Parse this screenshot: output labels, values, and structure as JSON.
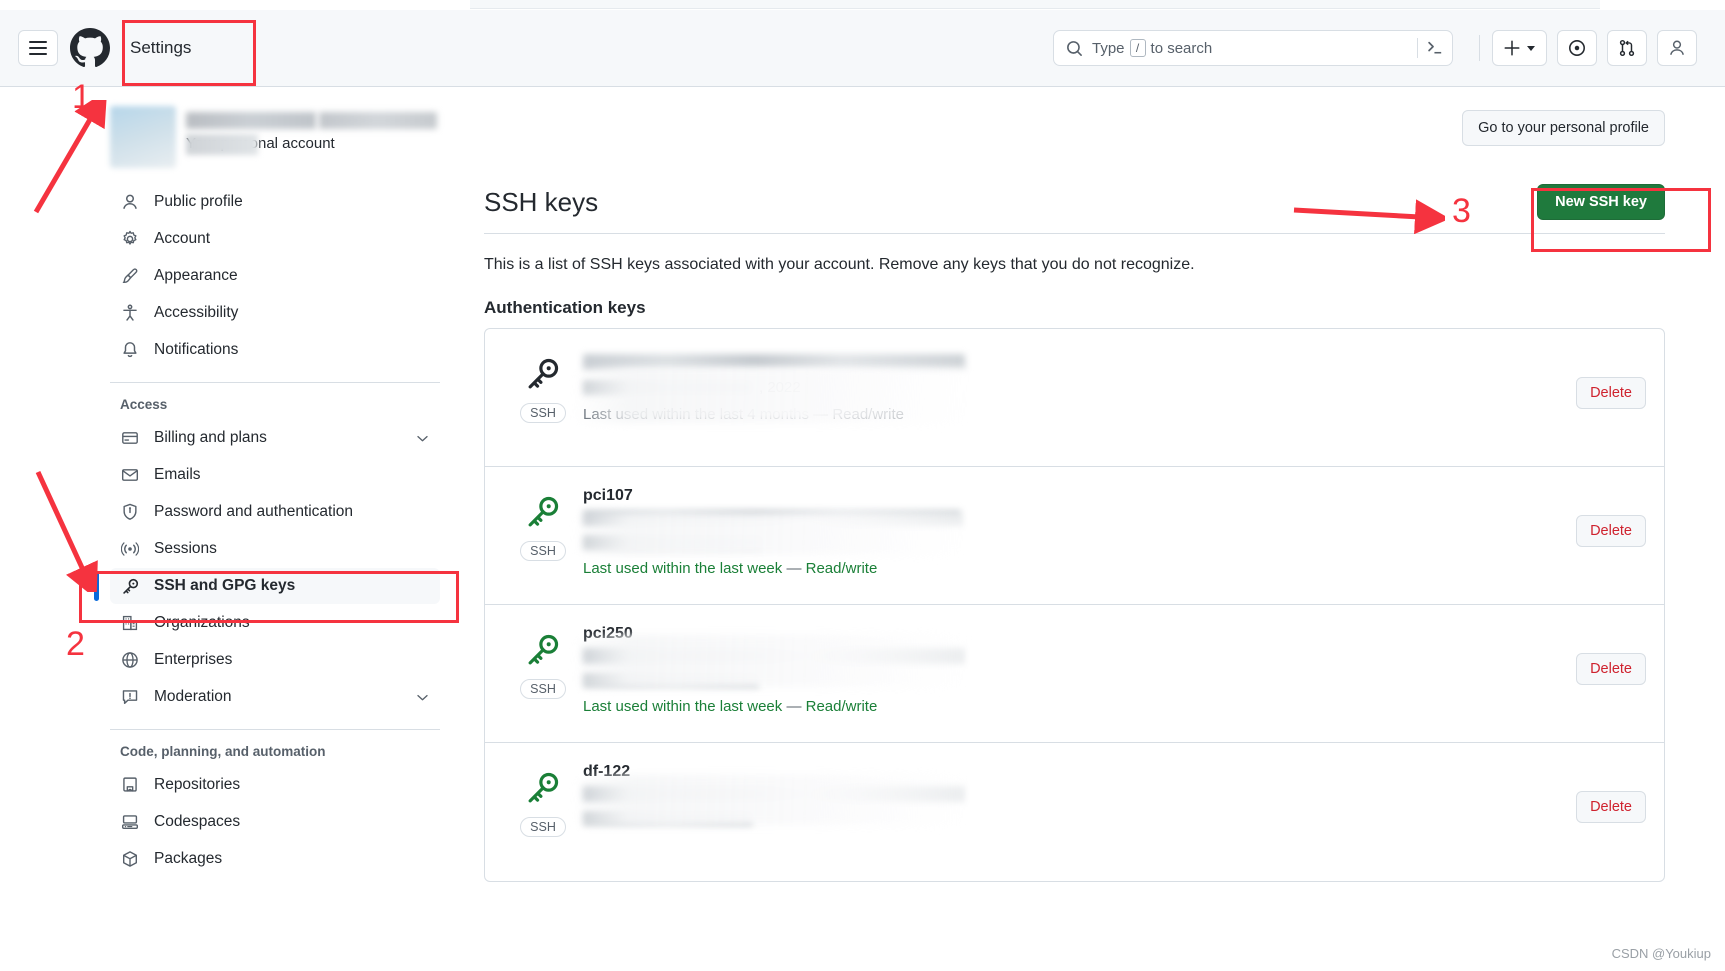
{
  "header": {
    "menu_label": "Open menu",
    "logo_label": "GitHub",
    "title": "Settings",
    "search": {
      "placeholder_prefix": "Type",
      "placeholder_key": "/",
      "placeholder_suffix": "to search"
    },
    "create_label": "Create new",
    "issues_label": "Issues",
    "pulls_label": "Pull requests"
  },
  "sidebar": {
    "account_subtitle": "Your personal account",
    "groups": [
      {
        "label": "",
        "items": [
          {
            "label": "Public profile",
            "icon": "person-icon",
            "expandable": false,
            "active": false
          },
          {
            "label": "Account",
            "icon": "gear-icon",
            "expandable": false,
            "active": false
          },
          {
            "label": "Appearance",
            "icon": "paintbrush-icon",
            "expandable": false,
            "active": false
          },
          {
            "label": "Accessibility",
            "icon": "accessibility-icon",
            "expandable": false,
            "active": false
          },
          {
            "label": "Notifications",
            "icon": "bell-icon",
            "expandable": false,
            "active": false
          }
        ]
      },
      {
        "label": "Access",
        "items": [
          {
            "label": "Billing and plans",
            "icon": "credit-card-icon",
            "expandable": true,
            "active": false
          },
          {
            "label": "Emails",
            "icon": "mail-icon",
            "expandable": false,
            "active": false
          },
          {
            "label": "Password and authentication",
            "icon": "shield-lock-icon",
            "expandable": false,
            "active": false
          },
          {
            "label": "Sessions",
            "icon": "broadcast-icon",
            "expandable": false,
            "active": false
          },
          {
            "label": "SSH and GPG keys",
            "icon": "key-icon",
            "expandable": false,
            "active": true
          },
          {
            "label": "Organizations",
            "icon": "organization-icon",
            "expandable": false,
            "active": false
          },
          {
            "label": "Enterprises",
            "icon": "globe-icon",
            "expandable": false,
            "active": false
          },
          {
            "label": "Moderation",
            "icon": "report-icon",
            "expandable": true,
            "active": false
          }
        ]
      },
      {
        "label": "Code, planning, and automation",
        "items": [
          {
            "label": "Repositories",
            "icon": "repo-icon",
            "expandable": false,
            "active": false
          },
          {
            "label": "Codespaces",
            "icon": "codespaces-icon",
            "expandable": false,
            "active": false
          },
          {
            "label": "Packages",
            "icon": "package-icon",
            "expandable": false,
            "active": false
          }
        ]
      }
    ]
  },
  "main": {
    "profile_button": "Go to your personal profile",
    "page_title": "SSH keys",
    "new_key_button": "New SSH key",
    "description": "This is a list of SSH keys associated with your account. Remove any keys that you do not recognize.",
    "section_title": "Authentication keys",
    "delete_label": "Delete",
    "ssh_badge": "SSH",
    "keys": [
      {
        "title": "",
        "title_redacted": true,
        "added_text": ", 2022",
        "status_prefix": "Last used within the last 4 months",
        "status_separator": "—",
        "status_suffix": "Read/write",
        "status_color": "gray",
        "key_icon_color": "#24292f"
      },
      {
        "title": "pci107",
        "title_redacted": false,
        "added_text": "",
        "status_prefix": "Last used within the last week",
        "status_separator": "—",
        "status_suffix": "Read/write",
        "status_color": "green",
        "key_icon_color": "#1a7f37"
      },
      {
        "title": "pci250",
        "title_redacted": false,
        "added_text": "",
        "status_prefix": "Last used within the last week",
        "status_separator": "—",
        "status_suffix": "Read/write",
        "status_color": "green",
        "key_icon_color": "#1a7f37"
      },
      {
        "title": "df-122",
        "title_redacted": false,
        "added_text": "",
        "status_prefix": "",
        "status_separator": "",
        "status_suffix": "",
        "status_color": "green",
        "key_icon_color": "#1a7f37"
      }
    ]
  },
  "annotations": [
    {
      "number": "1",
      "target": "settings-title"
    },
    {
      "number": "2",
      "target": "sidebar-item-ssh-and-gpg-keys"
    },
    {
      "number": "3",
      "target": "new-ssh-key-button"
    }
  ],
  "watermark": "CSDN @Youkiup",
  "colors": {
    "accent_green": "#1f7a3d",
    "annotation_red": "#f5333f",
    "active_blue": "#0969da",
    "danger_red": "#cf222e",
    "success_green": "#1a7f37"
  }
}
